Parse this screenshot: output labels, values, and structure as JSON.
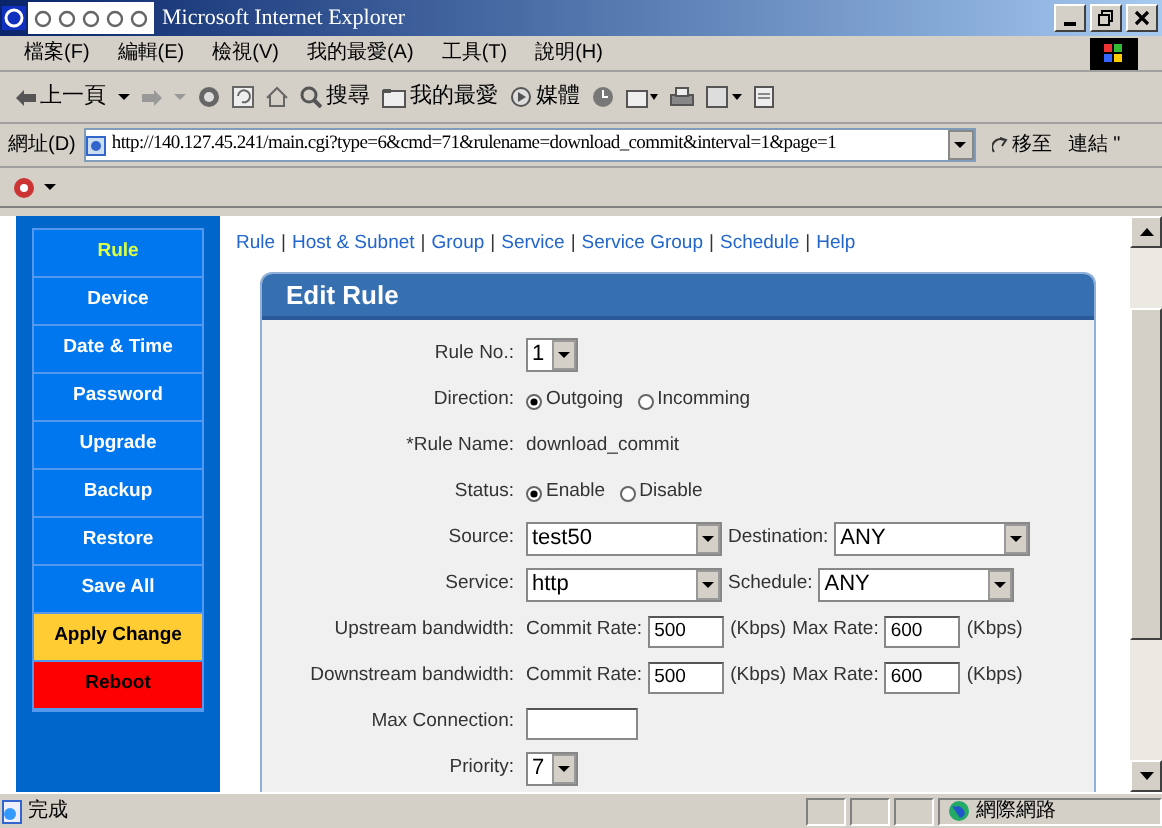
{
  "window": {
    "title": "Microsoft Internet Explorer"
  },
  "menu": [
    "檔案(F)",
    "編輯(E)",
    "檢視(V)",
    "我的最愛(A)",
    "工具(T)",
    "說明(H)"
  ],
  "toolbar": {
    "back": "上一頁",
    "search": "搜尋",
    "favorites": "我的最愛",
    "media": "媒體"
  },
  "address": {
    "label": "網址(D)",
    "value": "http://140.127.45.241/main.cgi?type=6&cmd=71&rulename=download_commit&interval=1&page=1",
    "go": "移至",
    "links": "連結 \""
  },
  "nav_links": [
    {
      "kind": "link",
      "text": "Rule"
    },
    {
      "kind": "separator",
      "text": "|"
    },
    {
      "kind": "link",
      "text": "Host & Subnet"
    },
    {
      "kind": "separator",
      "text": "|"
    },
    {
      "kind": "link",
      "text": "Group"
    },
    {
      "kind": "separator",
      "text": "|"
    },
    {
      "kind": "link",
      "text": "Service"
    },
    {
      "kind": "separator",
      "text": "|"
    },
    {
      "kind": "link",
      "text": "Service Group"
    },
    {
      "kind": "separator",
      "text": "|"
    },
    {
      "kind": "link",
      "text": "Schedule"
    },
    {
      "kind": "separator",
      "text": "|"
    },
    {
      "kind": "link",
      "text": "Help"
    }
  ],
  "sidebar": {
    "items": [
      {
        "label": "Rule",
        "kind": "normal",
        "selected": true
      },
      {
        "label": "Device",
        "kind": "normal",
        "selected": false
      },
      {
        "label": "Date & Time",
        "kind": "normal",
        "selected": false
      },
      {
        "label": "Password",
        "kind": "normal",
        "selected": false
      },
      {
        "label": "Upgrade",
        "kind": "normal",
        "selected": false
      },
      {
        "label": "Backup",
        "kind": "normal",
        "selected": false
      },
      {
        "label": "Restore",
        "kind": "normal",
        "selected": false
      },
      {
        "label": "Save All",
        "kind": "normal",
        "selected": false
      },
      {
        "label": "Apply Change",
        "kind": "apply",
        "selected": false
      },
      {
        "label": "Reboot",
        "kind": "reboot",
        "selected": false
      }
    ]
  },
  "panel": {
    "title": "Edit Rule",
    "rows": [
      {
        "label": "Rule No.:",
        "parts": [
          {
            "kind": "short_select",
            "value": "1"
          }
        ]
      },
      {
        "label": "Direction:",
        "parts": [
          {
            "kind": "radio",
            "label": "Outgoing",
            "selected": true
          },
          {
            "kind": "radio",
            "label": "Incomming",
            "selected": false
          }
        ]
      },
      {
        "label": "*Rule Name:",
        "parts": [
          {
            "kind": "text",
            "text": "download_commit"
          }
        ]
      },
      {
        "label": "Status:",
        "parts": [
          {
            "kind": "radio",
            "label": "Enable",
            "selected": true
          },
          {
            "kind": "radio",
            "label": "Disable",
            "selected": false
          }
        ]
      },
      {
        "label": "Source:",
        "parts": [
          {
            "kind": "select",
            "value": "test50"
          },
          {
            "kind": "label",
            "text": "Destination:"
          },
          {
            "kind": "select",
            "value": "ANY"
          }
        ]
      },
      {
        "label": "Service:",
        "parts": [
          {
            "kind": "select",
            "value": "http"
          },
          {
            "kind": "label",
            "text": "Schedule:"
          },
          {
            "kind": "select",
            "value": "ANY"
          }
        ]
      },
      {
        "label": "Upstream bandwidth:",
        "parts": [
          {
            "kind": "label",
            "text": "Commit Rate:"
          },
          {
            "kind": "rate_input",
            "value": "500"
          },
          {
            "kind": "label",
            "text": "(Kbps)"
          },
          {
            "kind": "label",
            "text": "Max Rate:"
          },
          {
            "kind": "rate_input",
            "value": "600"
          },
          {
            "kind": "label",
            "text": "(Kbps)"
          }
        ]
      },
      {
        "label": "Downstream bandwidth:",
        "parts": [
          {
            "kind": "label",
            "text": "Commit Rate:"
          },
          {
            "kind": "rate_input",
            "value": "500"
          },
          {
            "kind": "label",
            "text": "(Kbps)"
          },
          {
            "kind": "label",
            "text": "Max Rate:"
          },
          {
            "kind": "rate_input",
            "value": "600"
          },
          {
            "kind": "label",
            "text": "(Kbps)"
          }
        ]
      },
      {
        "label": "Max Connection:",
        "parts": [
          {
            "kind": "input"
          }
        ]
      },
      {
        "label": "Priority:",
        "parts": [
          {
            "kind": "short_select",
            "value": "7"
          }
        ]
      }
    ]
  },
  "status_bar": {
    "text": "完成",
    "zone": "網際網路"
  }
}
